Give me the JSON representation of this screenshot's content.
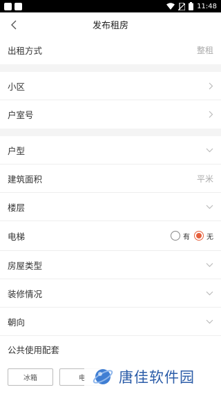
{
  "status_bar": {
    "time": "11:48"
  },
  "header": {
    "title": "发布租房"
  },
  "rows": {
    "rent_mode": {
      "label": "出租方式",
      "value": "整租"
    },
    "community": {
      "label": "小区"
    },
    "room_number": {
      "label": "户室号"
    },
    "layout": {
      "label": "户型"
    },
    "area": {
      "label": "建筑面积",
      "unit": "平米"
    },
    "floor": {
      "label": "楼层"
    },
    "elevator": {
      "label": "电梯",
      "options": [
        "有",
        "无"
      ],
      "selected": "无"
    },
    "house_type": {
      "label": "房屋类型"
    },
    "decoration": {
      "label": "装修情况"
    },
    "orientation": {
      "label": "朝向"
    }
  },
  "facilities": {
    "title": "公共使用配套",
    "items": [
      "冰箱",
      "电"
    ]
  },
  "watermark": {
    "text": "唐佳软件园"
  },
  "colors": {
    "accent": "#e65f3b",
    "divider": "#f4f4f4"
  }
}
